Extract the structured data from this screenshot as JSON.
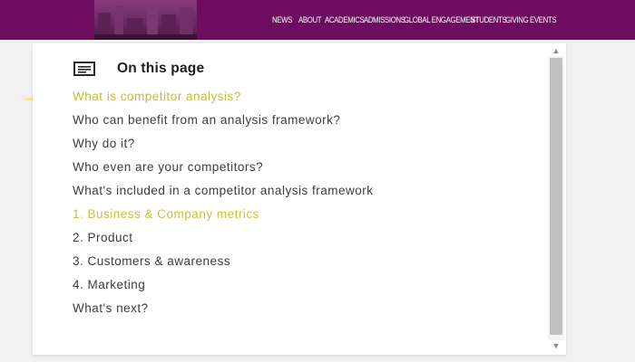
{
  "header": {
    "banner_icon": "campus-skyline-image",
    "nav": [
      "NEWS",
      "ABOUT",
      "ACADEMICS",
      "ADMISSIONS",
      "GLOBAL ENGAGEMENT",
      "STUDENTS",
      "GIVING",
      "EVENTS"
    ]
  },
  "toc": {
    "icon": "list-icon",
    "title": "On this page",
    "items": [
      "What is competitor analysis?",
      "Who can benefit from an analysis framework?",
      "Why do it?",
      "Who even are your competitors?",
      "What's included in a competitor analysis framework",
      "1. Business & Company metrics",
      "2. Product",
      "3. Customers & awareness",
      "4. Marketing",
      "What's next?"
    ],
    "active_index": 0
  },
  "colors": {
    "brand": "#6e0d5f",
    "active_accent": "#f3e640",
    "active_text": "#c8b93a",
    "text": "#3c3c3c"
  }
}
